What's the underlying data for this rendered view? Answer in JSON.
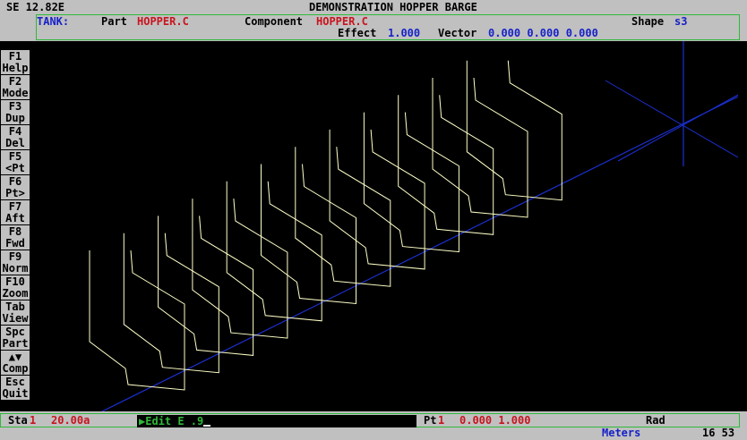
{
  "app": {
    "version": "SE 12.82E",
    "title": "DEMONSTRATION HOPPER BARGE"
  },
  "header": {
    "tank_label": "TANK:",
    "part_label": "Part",
    "part_value": "HOPPER.C",
    "component_label": "Component",
    "component_value": "HOPPER.C",
    "shape_label": "Shape",
    "shape_value": "s3",
    "effect_label": "Effect",
    "effect_value": "1.000",
    "vector_label": "Vector",
    "vector_value": "0.000 0.000 0.000"
  },
  "function_keys": [
    {
      "key": "F1",
      "label": "Help"
    },
    {
      "key": "F2",
      "label": "Mode"
    },
    {
      "key": "F3",
      "label": "Dup"
    },
    {
      "key": "F4",
      "label": "Del"
    },
    {
      "key": "F5",
      "label": "<Pt"
    },
    {
      "key": "F6",
      "label": "Pt>"
    },
    {
      "key": "F7",
      "label": "Aft"
    },
    {
      "key": "F8",
      "label": "Fwd"
    },
    {
      "key": "F9",
      "label": "Norm"
    },
    {
      "key": "F10",
      "label": "Zoom"
    },
    {
      "key": "Tab",
      "label": "View"
    },
    {
      "key": "Spc",
      "label": "Part"
    },
    {
      "key": "▲▼",
      "label": "Comp"
    },
    {
      "key": "Esc",
      "label": "Quit"
    }
  ],
  "status": {
    "sta_label": "Sta",
    "sta_index": "1",
    "sta_value": "20.00a",
    "edit_prompt": "▶Edit E .9",
    "pt_label": "Pt",
    "pt_index": "1",
    "pt_value": "0.000 1.000",
    "angle_unit": "Rad",
    "units": "Meters",
    "counter": "16 53"
  },
  "colors": {
    "section_lines": "#ffffc8",
    "centerline": "#1c2fd0",
    "axis_marker": "#1c2fd0",
    "frame_border": "#2fb83a",
    "label_red": "#c8141e",
    "value_blue": "#1722c8"
  }
}
